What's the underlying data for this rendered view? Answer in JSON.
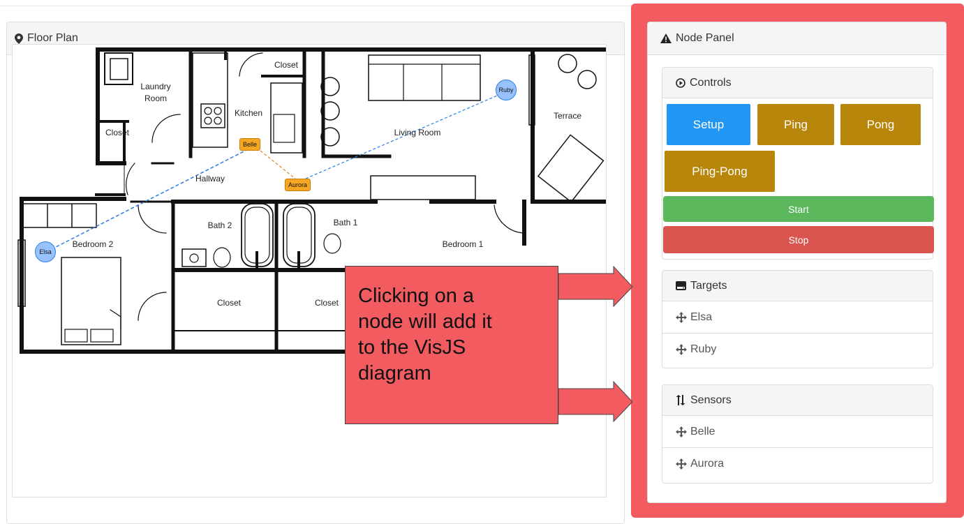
{
  "floor_plan": {
    "title": "Floor Plan",
    "rooms": {
      "closet_top": "Closet",
      "laundry_line1": "Laundry",
      "laundry_line2": "Room",
      "kitchen": "Kitchen",
      "closet_left": "Closet",
      "living_room": "Living Room",
      "terrace": "Terrace",
      "hallway": "Hallway",
      "bath2": "Bath 2",
      "bath1": "Bath 1",
      "bedroom2": "Bedroom 2",
      "bedroom1": "Bedroom 1",
      "closet_bottom1": "Closet",
      "closet_bottom2": "Closet"
    },
    "nodes": {
      "ruby": "Ruby",
      "belle": "Belle",
      "aurora": "Aurora",
      "elsa": "Elsa"
    },
    "colors": {
      "circle_node": "#97c2fc",
      "box_node": "#f5a623",
      "edge_blue": "#2b7ce9",
      "edge_orange": "#e08a2b"
    }
  },
  "node_panel": {
    "title": "Node Panel",
    "controls": {
      "title": "Controls",
      "buttons": {
        "setup": "Setup",
        "ping": "Ping",
        "pong": "Pong",
        "ping_pong": "Ping-Pong",
        "start": "Start",
        "stop": "Stop"
      }
    },
    "targets": {
      "title": "Targets",
      "items": [
        "Elsa",
        "Ruby"
      ]
    },
    "sensors": {
      "title": "Sensors",
      "items": [
        "Belle",
        "Aurora"
      ]
    }
  },
  "callout": {
    "lines": [
      "Clicking on a",
      "node will add it",
      "to the VisJS",
      "diagram"
    ]
  },
  "icons": {
    "floor_plan": "map-marker-icon",
    "node_panel": "warning-triangle-icon",
    "controls": "play-circle-icon",
    "targets": "hdd-icon",
    "sensors": "sort-arrows-icon",
    "list_item": "move-arrows-icon"
  }
}
